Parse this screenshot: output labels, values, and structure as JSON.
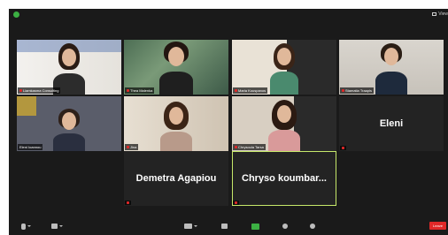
{
  "view_label": "View",
  "participants": [
    {
      "name": "Liamkasma Consulting"
    },
    {
      "name": "Thea Malenka"
    },
    {
      "name": "Maria Kouspanos"
    },
    {
      "name": "Stamatia Traapis"
    },
    {
      "name": "Eleni Ioannou"
    },
    {
      "name": "Jina"
    },
    {
      "name": "Chrysoula Tarsa"
    },
    {
      "name": "Eleni"
    },
    {
      "name": "Demetra Agapiou"
    },
    {
      "name": "Chryso  koumbar..."
    }
  ],
  "toolbar": {
    "leave_label": "Leave"
  },
  "colors": {
    "background": "#1a1a1a",
    "active_speaker": "#c6e86a",
    "leave": "#e02828",
    "share": "#3cb043"
  }
}
